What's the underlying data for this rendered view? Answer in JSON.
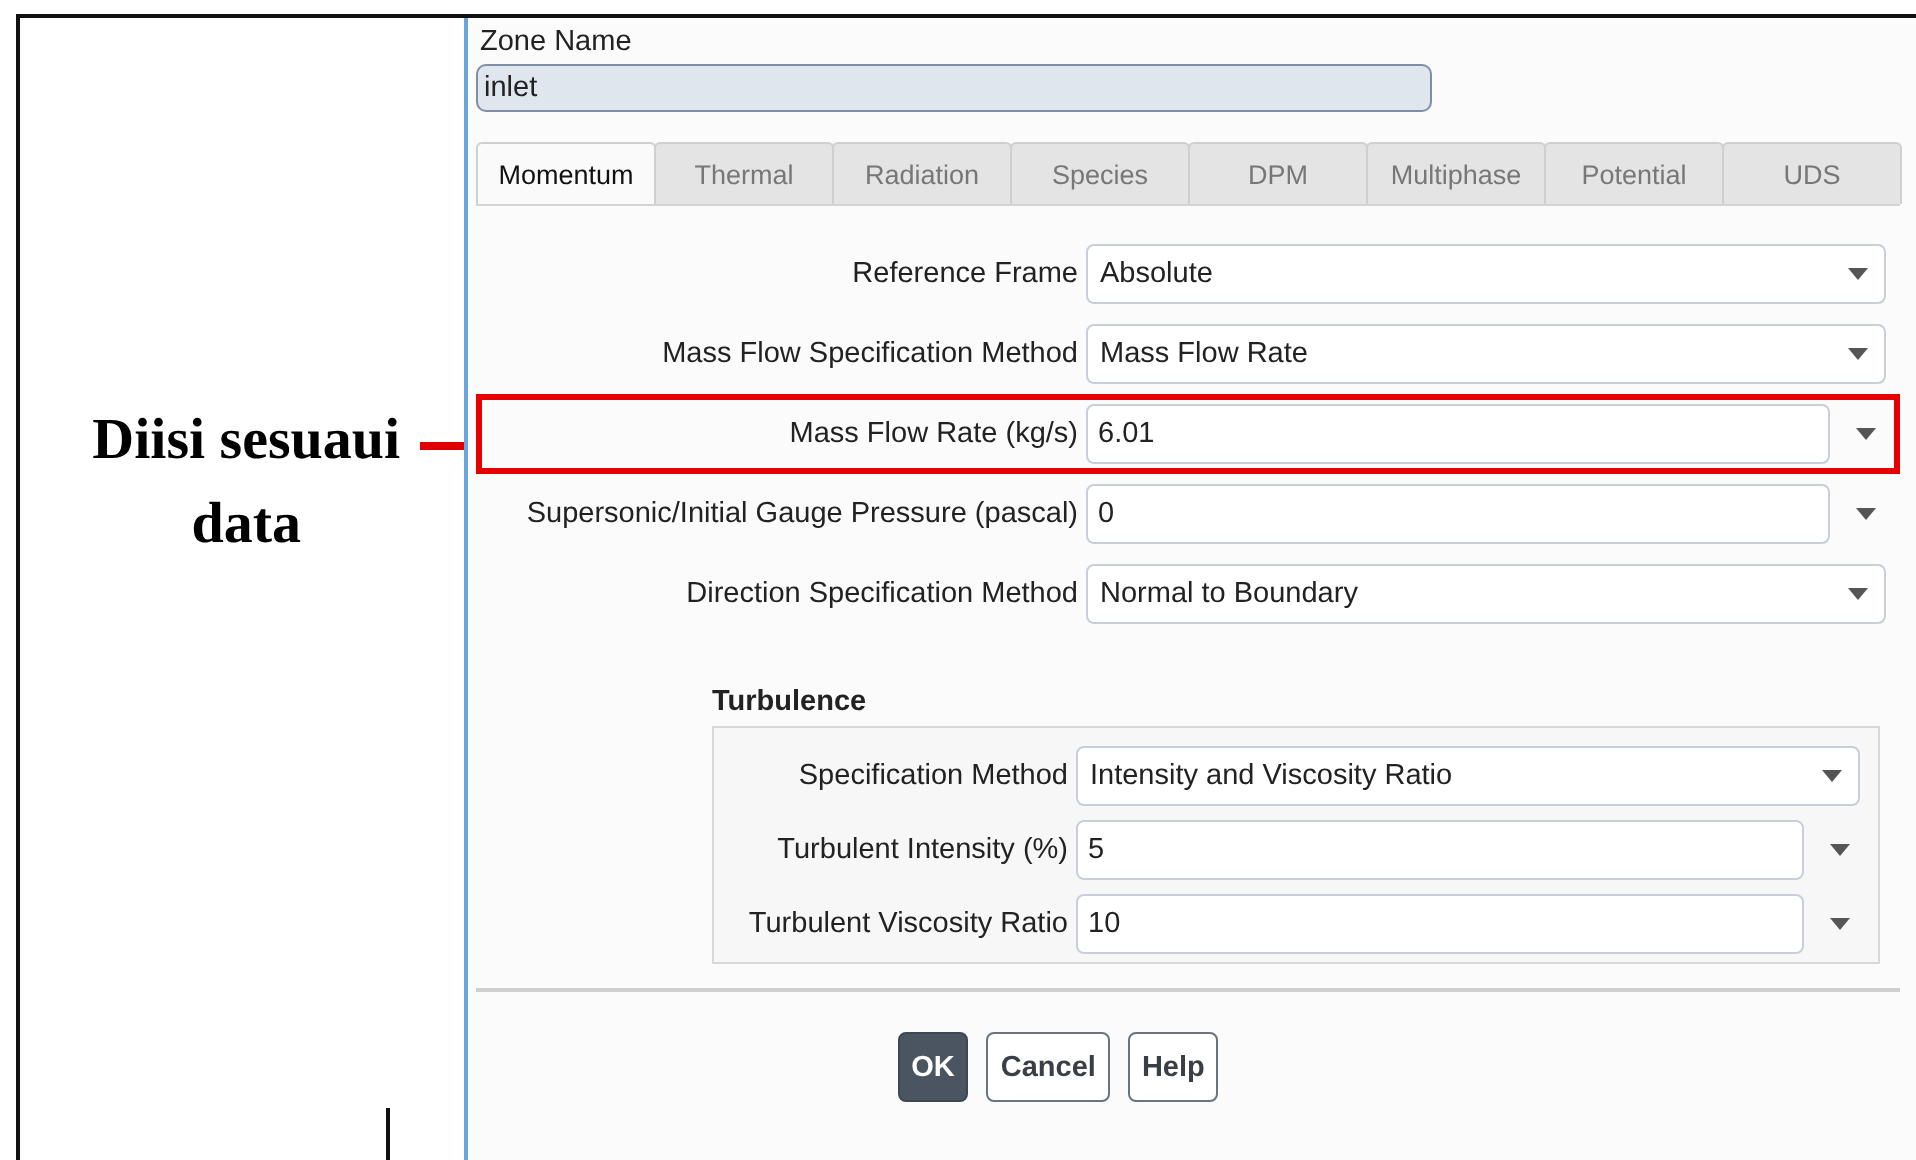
{
  "annotation": {
    "text": "Diisi sesuaui data"
  },
  "zone_name": {
    "label": "Zone Name",
    "value": "inlet"
  },
  "tabs": [
    {
      "label": "Momentum",
      "selected": true
    },
    {
      "label": "Thermal",
      "selected": false
    },
    {
      "label": "Radiation",
      "selected": false
    },
    {
      "label": "Species",
      "selected": false
    },
    {
      "label": "DPM",
      "selected": false
    },
    {
      "label": "Multiphase",
      "selected": false
    },
    {
      "label": "Potential",
      "selected": false
    },
    {
      "label": "UDS",
      "selected": false
    }
  ],
  "fields": [
    {
      "kind": "dropdown",
      "label": "Reference Frame",
      "value": "Absolute",
      "highlighted": false
    },
    {
      "kind": "dropdown",
      "label": "Mass Flow Specification Method",
      "value": "Mass Flow Rate",
      "highlighted": false
    },
    {
      "kind": "number",
      "label": "Mass Flow Rate (kg/s)",
      "value": "6.01",
      "highlighted": true
    },
    {
      "kind": "number",
      "label": "Supersonic/Initial Gauge Pressure (pascal)",
      "value": "0",
      "highlighted": false
    },
    {
      "kind": "dropdown",
      "label": "Direction Specification Method",
      "value": "Normal to Boundary",
      "highlighted": false
    }
  ],
  "turbulence": {
    "title": "Turbulence",
    "fields": [
      {
        "kind": "dropdown",
        "label": "Specification Method",
        "value": "Intensity and Viscosity Ratio"
      },
      {
        "kind": "number",
        "label": "Turbulent Intensity (%)",
        "value": "5"
      },
      {
        "kind": "number",
        "label": "Turbulent Viscosity Ratio",
        "value": "10"
      }
    ]
  },
  "buttons": [
    {
      "label": "OK",
      "primary": true
    },
    {
      "label": "Cancel",
      "primary": false
    },
    {
      "label": "Help",
      "primary": false
    }
  ]
}
